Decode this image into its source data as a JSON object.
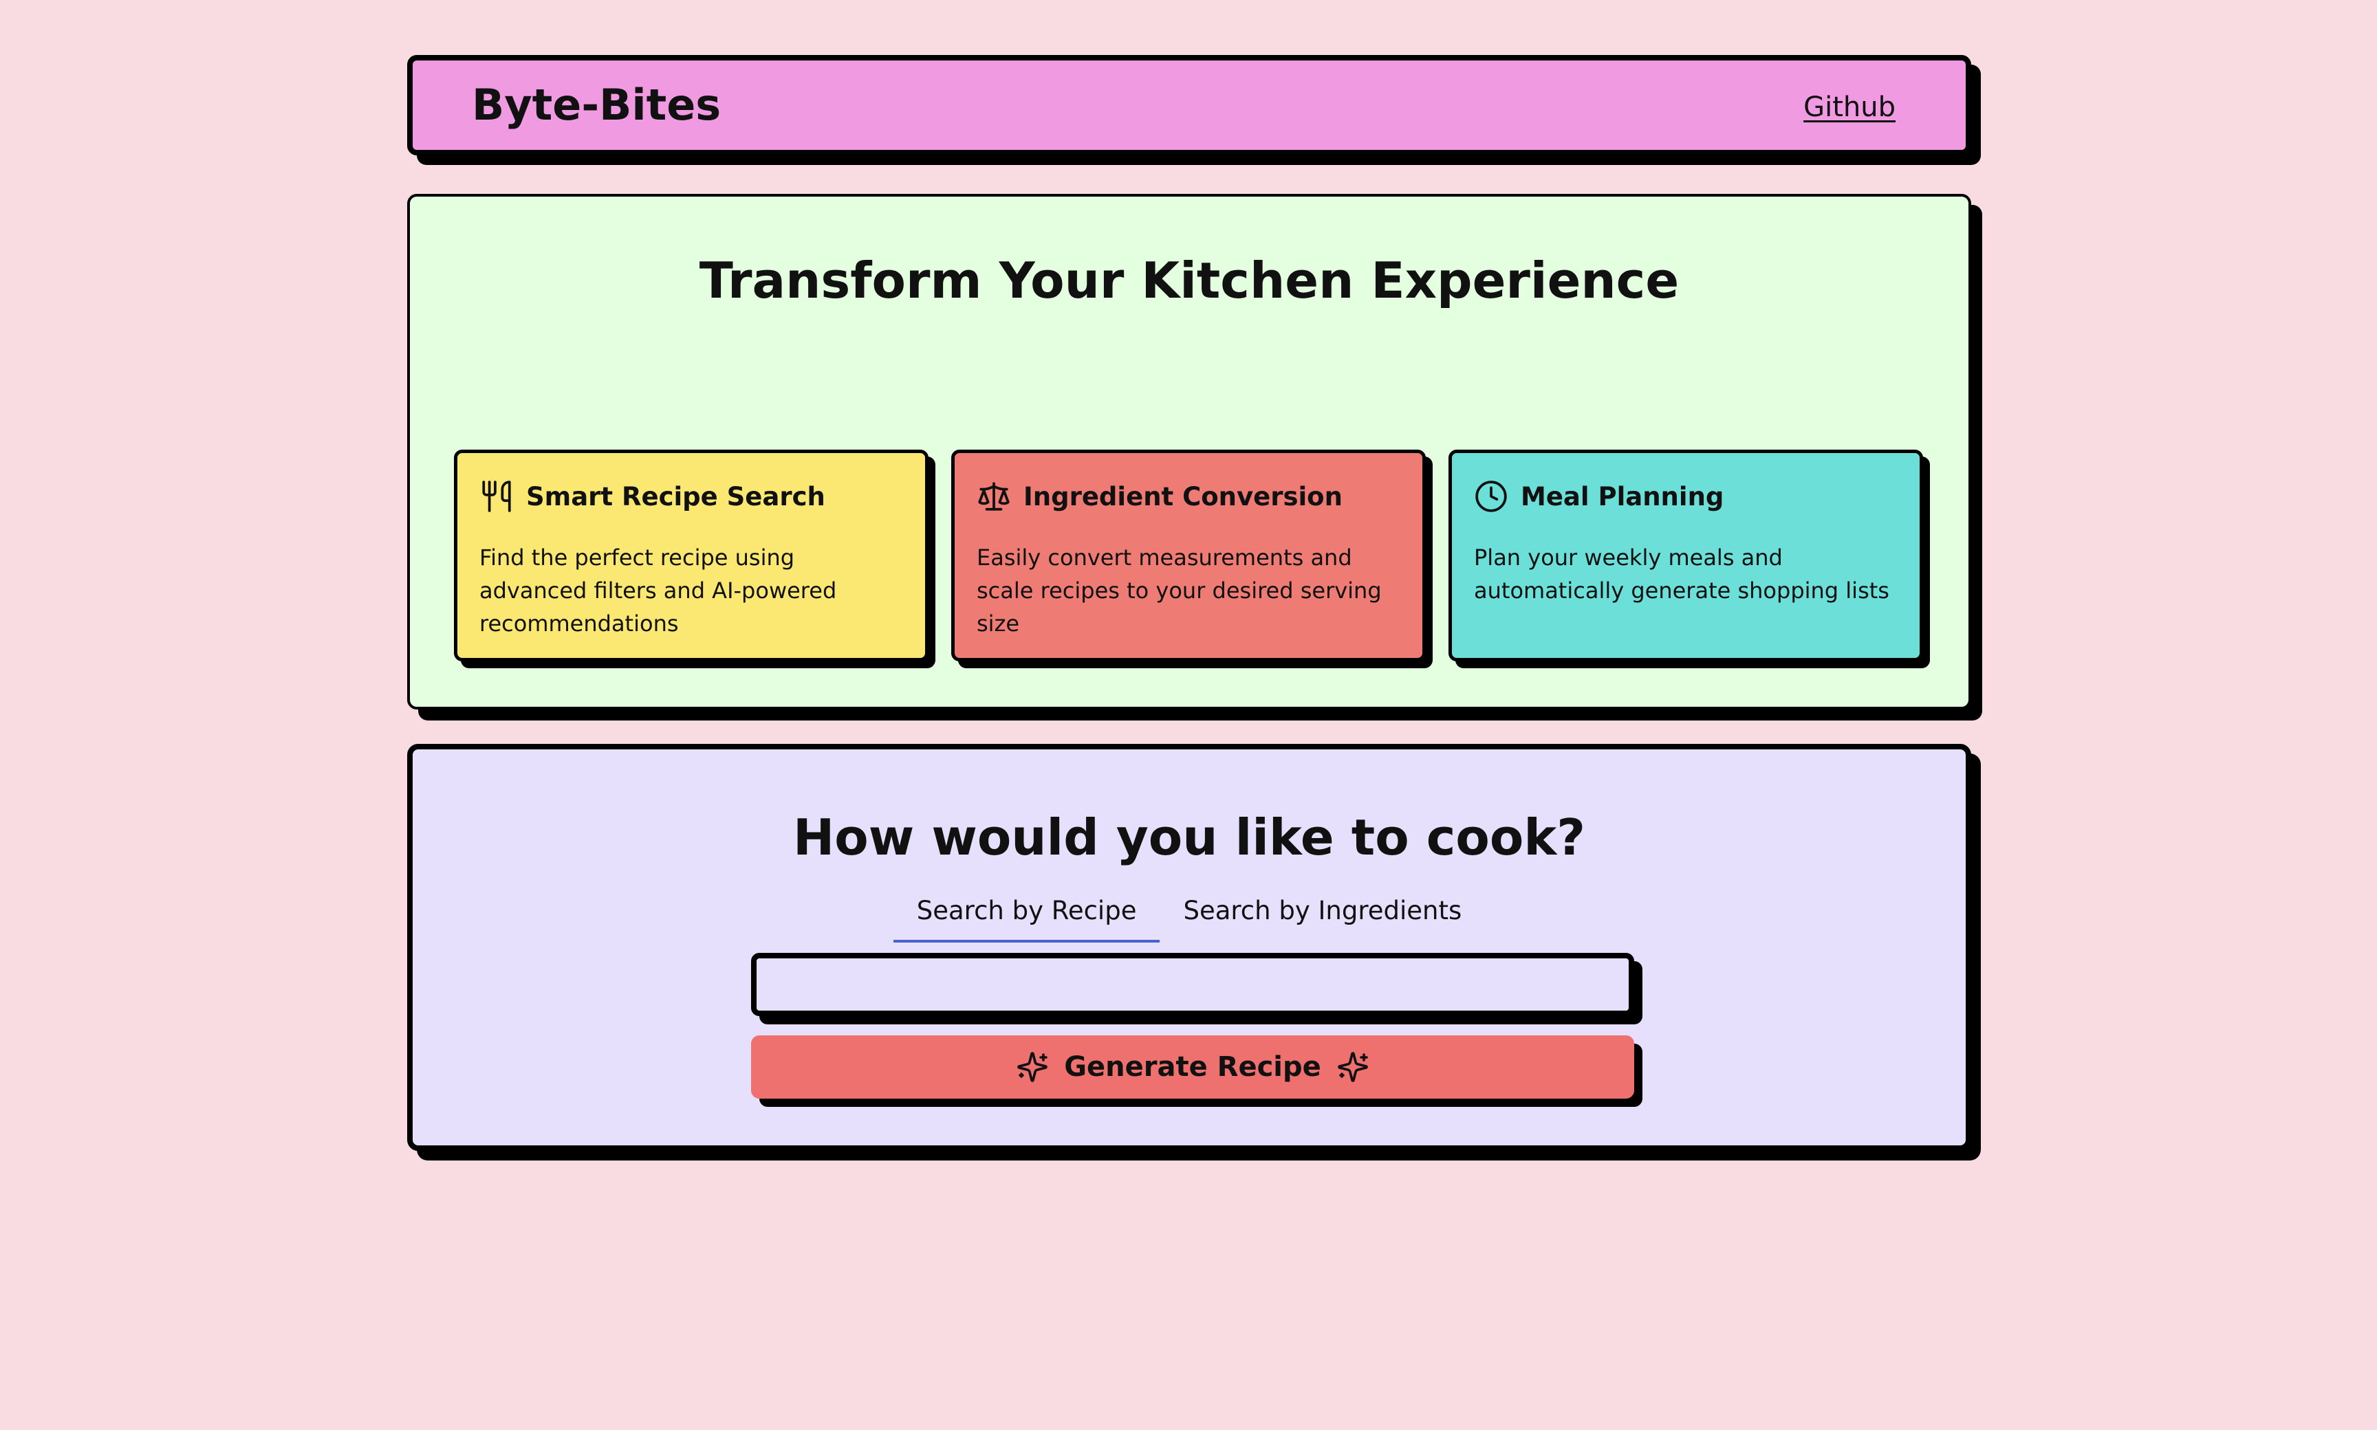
{
  "header": {
    "brand": "Byte-Bites",
    "github_link": "Github",
    "background": "#f09ae2"
  },
  "hero": {
    "title": "Transform Your Kitchen Experience",
    "background": "#e4ffe0",
    "features": [
      {
        "icon": "utensils-icon",
        "title": "Smart Recipe Search",
        "description": "Find the perfect recipe using advanced filters and AI-powered recommendations",
        "color": "#fae873"
      },
      {
        "icon": "scale-icon",
        "title": "Ingredient Conversion",
        "description": "Easily convert measurements and scale recipes to your desired serving size",
        "color": "#ee7b74"
      },
      {
        "icon": "clock-icon",
        "title": "Meal Planning",
        "description": "Plan your weekly meals and automatically generate shopping lists",
        "color": "#6bdfd8"
      }
    ]
  },
  "cook": {
    "title": "How would you like to cook?",
    "background": "#e6e0fd",
    "tabs": [
      {
        "label": "Search by Recipe",
        "active": true
      },
      {
        "label": "Search by Ingredients",
        "active": false
      }
    ],
    "search": {
      "value": "",
      "placeholder": ""
    },
    "generate_button": {
      "label": "Generate Recipe",
      "icon": "sparkles-icon",
      "color": "#ee716f"
    }
  },
  "page": {
    "background": "#f9dce1",
    "accent_tab_underline": "#4b63d2"
  }
}
